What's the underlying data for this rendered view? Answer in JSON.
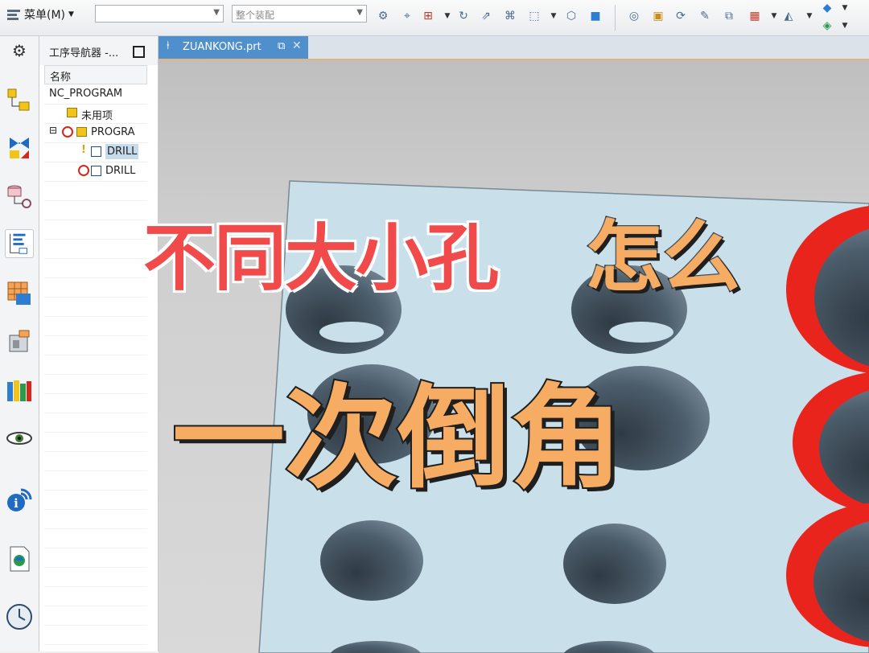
{
  "toolbar": {
    "menu_label": "菜单(M)",
    "filter_combo": "",
    "assembly_combo": "整个装配"
  },
  "navigator": {
    "title": "工序导航器 -...",
    "column_header": "名称",
    "rows": [
      {
        "label": "NC_PROGRAM"
      },
      {
        "label": "未用项"
      },
      {
        "label": "PROGRA"
      },
      {
        "label": "DRILL"
      },
      {
        "label": "DRILL"
      }
    ]
  },
  "tab": {
    "label": "ZUANKONG.prt"
  },
  "caption": {
    "line1_red": "不同大小孔",
    "line1_orange": "怎么",
    "line2": "一次倒角"
  },
  "colors": {
    "caption_red": "#f14a4a",
    "caption_orange": "#f7ac64",
    "plate": "#c9e0ea",
    "chamfer_red": "#e8241c",
    "active_tab": "#4f8fcc"
  },
  "icons": [
    "menu-icon",
    "settings-icon",
    "geometry-view-icon",
    "machine-tool-icon",
    "machining-method-icon",
    "program-order-icon",
    "feature-icon",
    "machine-icon",
    "library-icon",
    "eye-icon",
    "info-icon",
    "doc-icon",
    "clock-icon"
  ]
}
